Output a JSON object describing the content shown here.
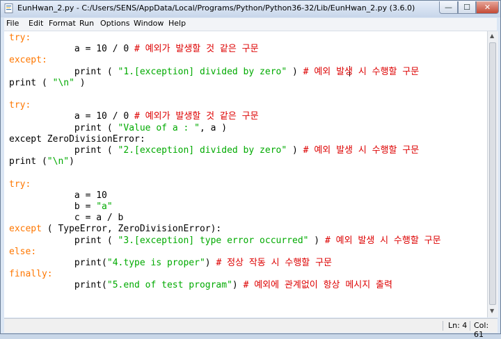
{
  "window": {
    "title": "EunHwan_2.py - C:/Users/SENS/AppData/Local/Programs/Python/Python36-32/Lib/EunHwan_2.py (3.6.0)",
    "controls": {
      "minimize": "—",
      "maximize": "☐",
      "close": "✕"
    }
  },
  "menu": {
    "items": [
      {
        "label": "File",
        "accel": "F"
      },
      {
        "label": "Edit",
        "accel": "E"
      },
      {
        "label": "Format",
        "accel": "o"
      },
      {
        "label": "Run",
        "accel": "R"
      },
      {
        "label": "Options",
        "accel": "O"
      },
      {
        "label": "Window",
        "accel": "W"
      },
      {
        "label": "Help",
        "accel": "H"
      }
    ]
  },
  "editor": {
    "colors": {
      "keyword": "#ff7700",
      "string": "#00aa00",
      "comment": "#dd0000",
      "builtin": "#900090"
    },
    "lines": [
      [
        {
          "t": "try",
          "c": "kw"
        },
        {
          "t": ":",
          "c": "kw"
        }
      ],
      [
        {
          "t": "            a = 10 / 0 "
        },
        {
          "t": "# 예외가 발생할 것 같은 구문",
          "c": "cmt"
        }
      ],
      [
        {
          "t": "except",
          "c": "kw"
        },
        {
          "t": ":",
          "c": "kw"
        }
      ],
      [
        {
          "t": "            print ( "
        },
        {
          "t": "\"1.[exception] divided by zero\"",
          "c": "str"
        },
        {
          "t": " ) "
        },
        {
          "t": "# 예외 발생 시 수행할 구문",
          "c": "cmt"
        }
      ],
      [
        {
          "t": "print ( "
        },
        {
          "t": "\"\\n\"",
          "c": "str"
        },
        {
          "t": " )"
        }
      ],
      [
        {
          "t": ""
        }
      ],
      [
        {
          "t": "try",
          "c": "kw"
        },
        {
          "t": ":",
          "c": "kw"
        }
      ],
      [
        {
          "t": "            a = 10 / 0 "
        },
        {
          "t": "# 예외가 발생할 것 같은 구문",
          "c": "cmt"
        }
      ],
      [
        {
          "t": "            print ( "
        },
        {
          "t": "\"Value of a : \"",
          "c": "str"
        },
        {
          "t": ", a )"
        }
      ],
      [
        {
          "t": "except ZeroDivisionError:"
        }
      ],
      [
        {
          "t": "            print ( "
        },
        {
          "t": "\"2.[exception] divided by zero\"",
          "c": "str"
        },
        {
          "t": " ) "
        },
        {
          "t": "# 예외 발생 시 수행할 구문",
          "c": "cmt"
        }
      ],
      [
        {
          "t": "print ("
        },
        {
          "t": "\"\\n\"",
          "c": "str"
        },
        {
          "t": ")"
        }
      ],
      [
        {
          "t": ""
        }
      ],
      [
        {
          "t": "try",
          "c": "kw"
        },
        {
          "t": ":",
          "c": "kw"
        }
      ],
      [
        {
          "t": "            a = 10"
        }
      ],
      [
        {
          "t": "            b = "
        },
        {
          "t": "\"a\"",
          "c": "str"
        }
      ],
      [
        {
          "t": "            c = a / b"
        }
      ],
      [
        {
          "t": "except",
          "c": "kw"
        },
        {
          "t": " ( TypeError, ZeroDivisionError):"
        }
      ],
      [
        {
          "t": "            print ( "
        },
        {
          "t": "\"3.[exception] type error occurred\"",
          "c": "str"
        },
        {
          "t": " ) "
        },
        {
          "t": "# 예외 발생 시 수행할 구문",
          "c": "cmt"
        }
      ],
      [
        {
          "t": "else",
          "c": "kw"
        },
        {
          "t": ":",
          "c": "kw"
        }
      ],
      [
        {
          "t": "            print("
        },
        {
          "t": "\"4.type is proper\"",
          "c": "str"
        },
        {
          "t": ") "
        },
        {
          "t": "# 정상 작동 시 수행할 구문",
          "c": "cmt"
        }
      ],
      [
        {
          "t": "finally",
          "c": "kw"
        },
        {
          "t": ":",
          "c": "kw"
        }
      ],
      [
        {
          "t": "            print("
        },
        {
          "t": "\"5.end of test program\"",
          "c": "str"
        },
        {
          "t": ") "
        },
        {
          "t": "# 예외에 관계없이 항상 메시지 출력",
          "c": "cmt"
        }
      ]
    ]
  },
  "status": {
    "line": "Ln: 4",
    "col": "Col: 61"
  }
}
